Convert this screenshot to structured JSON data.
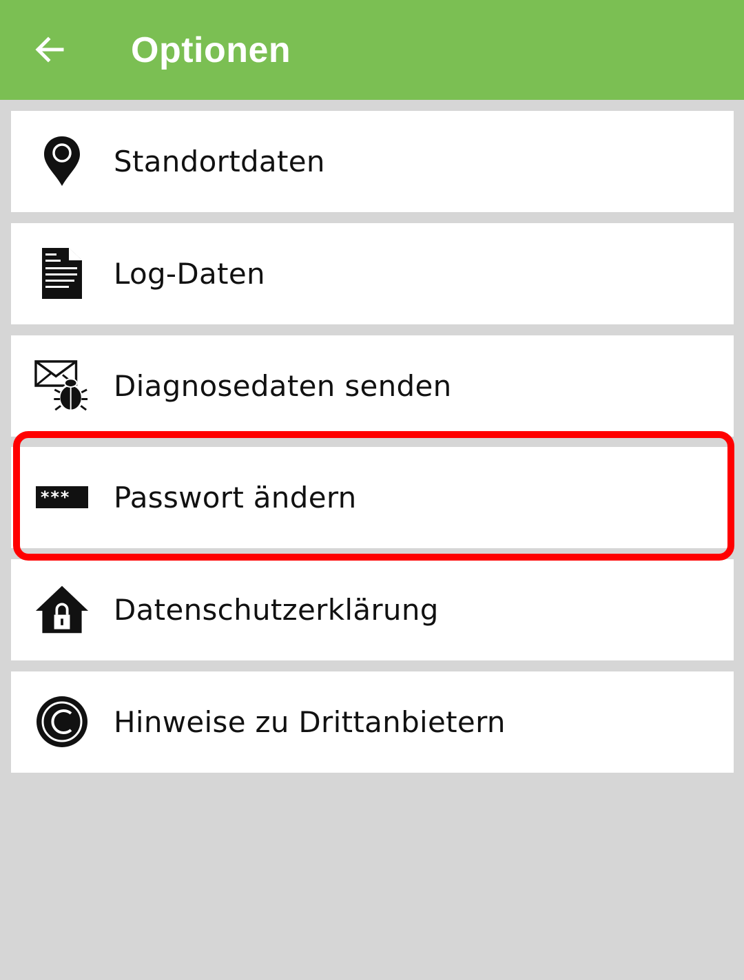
{
  "header": {
    "title": "Optionen",
    "back_icon": "arrow-left-icon",
    "background_color": "#7bbf53"
  },
  "menu": {
    "items": [
      {
        "label": "Standortdaten",
        "icon": "location-pin-icon"
      },
      {
        "label": "Log-Daten",
        "icon": "document-icon"
      },
      {
        "label": "Diagnosedaten senden",
        "icon": "mail-bug-icon"
      },
      {
        "label": "Passwort ändern",
        "icon": "password-field-icon",
        "highlighted": true
      },
      {
        "label": "Datenschutzerklärung",
        "icon": "house-lock-icon"
      },
      {
        "label": "Hinweise zu Drittanbietern",
        "icon": "copyright-icon"
      }
    ]
  },
  "highlight": {
    "color": "#ff0000"
  }
}
